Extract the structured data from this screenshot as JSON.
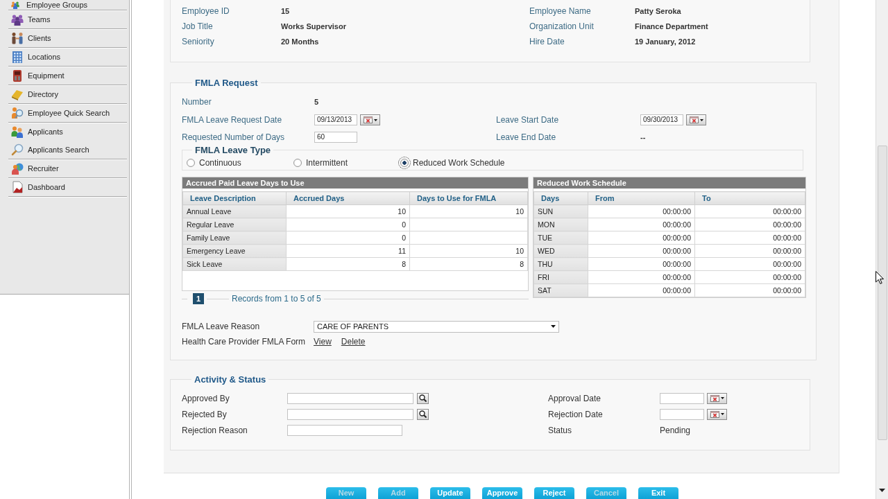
{
  "sidebar": {
    "groups": [
      {
        "items": [
          {
            "label": "Employee Groups"
          }
        ]
      },
      {
        "items": [
          {
            "label": "Teams"
          }
        ]
      },
      {
        "items": [
          {
            "label": "Clients"
          }
        ]
      },
      {
        "items": [
          {
            "label": "Locations"
          }
        ]
      },
      {
        "items": [
          {
            "label": "Equipment"
          }
        ]
      },
      {
        "items": [
          {
            "label": "Directory"
          }
        ]
      },
      {
        "items": [
          {
            "label": "Employee Quick Search"
          }
        ]
      },
      {
        "items": [
          {
            "label": "Applicants"
          },
          {
            "label": "Applicants Search"
          }
        ]
      },
      {
        "items": [
          {
            "label": "Recruiter"
          }
        ]
      },
      {
        "items": [
          {
            "label": "Dashboard"
          }
        ]
      }
    ]
  },
  "employee": {
    "rows": [
      [
        {
          "label": "Employee ID",
          "value": "15"
        },
        {
          "label": "Employee Name",
          "value": "Patty Seroka"
        }
      ],
      [
        {
          "label": "Job Title",
          "value": "Works Supervisor"
        },
        {
          "label": "Organization Unit",
          "value": "Finance Department"
        }
      ],
      [
        {
          "label": "Seniority",
          "value": "20 Months"
        },
        {
          "label": "Hire Date",
          "value": "19 January, 2012"
        }
      ]
    ]
  },
  "fmla_request": {
    "title": "FMLA Request",
    "fields": [
      [
        {
          "kind": "display",
          "label": "Number",
          "value": "5"
        }
      ],
      [
        {
          "kind": "date",
          "label": "FMLA Leave Request Date",
          "value": "09/13/2013"
        },
        {
          "kind": "date",
          "label": "Leave Start Date",
          "value": "09/30/2013"
        }
      ],
      [
        {
          "kind": "text",
          "label": "Requested Number of Days",
          "value": "60"
        },
        {
          "kind": "display",
          "label": "Leave End Date",
          "value": "--"
        }
      ]
    ],
    "leave_type": {
      "title": "FMLA Leave Type",
      "options": [
        {
          "label": "Continuous",
          "selected": false
        },
        {
          "label": "Intermittent",
          "selected": false
        },
        {
          "label": "Reduced Work Schedule",
          "selected": true
        }
      ]
    },
    "accrued_table": {
      "title": "Accrued Paid Leave Days to Use",
      "columns": [
        "Leave Description",
        "Accrued Days",
        "Days to Use for FMLA"
      ],
      "rows": [
        {
          "description": "Annual Leave",
          "accrued": "10",
          "fmla_days": "10"
        },
        {
          "description": "Regular Leave",
          "accrued": "0"
        },
        {
          "description": "Family Leave",
          "accrued": "0"
        },
        {
          "description": "Emergency Leave",
          "accrued": "11",
          "fmla_days": "10"
        },
        {
          "description": "Sick Leave",
          "accrued": "8",
          "fmla_days": "8"
        }
      ],
      "pager": {
        "pages": [
          {
            "label": "1",
            "selected": true
          }
        ],
        "summary": "Records from 1 to 5 of 5"
      }
    },
    "schedule_table": {
      "title": "Reduced Work Schedule",
      "columns": [
        "Days",
        "From",
        "To"
      ],
      "rows": [
        {
          "day": "SUN",
          "from": "00:00:00",
          "to": "00:00:00"
        },
        {
          "day": "MON",
          "from": "00:00:00",
          "to": "00:00:00"
        },
        {
          "day": "TUE",
          "from": "00:00:00",
          "to": "00:00:00"
        },
        {
          "day": "WED",
          "from": "00:00:00",
          "to": "00:00:00"
        },
        {
          "day": "THU",
          "from": "00:00:00",
          "to": "00:00:00"
        },
        {
          "day": "FRI",
          "from": "00:00:00",
          "to": "00:00:00"
        },
        {
          "day": "SAT",
          "from": "00:00:00",
          "to": "00:00:00"
        }
      ]
    },
    "reason": {
      "label": "FMLA Leave Reason",
      "value": "CARE OF PARENTS"
    },
    "provider_form": {
      "label": "Health Care Provider FMLA Form",
      "links": [
        "View",
        "Delete"
      ]
    }
  },
  "activity": {
    "title": "Activity & Status",
    "rows": [
      [
        {
          "kind": "lookup",
          "label": "Approved By"
        },
        {
          "kind": "date",
          "label": "Approval Date"
        }
      ],
      [
        {
          "kind": "lookup",
          "label": "Rejected By"
        },
        {
          "kind": "date",
          "label": "Rejection Date"
        }
      ],
      [
        {
          "kind": "text",
          "label": "Rejection Reason"
        },
        {
          "kind": "display",
          "label": "Status",
          "value": "Pending"
        }
      ]
    ]
  },
  "buttons": [
    {
      "label": "New",
      "disabled": true
    },
    {
      "label": "Add",
      "disabled": true
    },
    {
      "label": "Update",
      "disabled": false
    },
    {
      "label": "Approve",
      "disabled": false
    },
    {
      "label": "Reject",
      "disabled": false
    },
    {
      "label": "Cancel",
      "disabled": true
    },
    {
      "label": "Exit",
      "disabled": false
    }
  ]
}
